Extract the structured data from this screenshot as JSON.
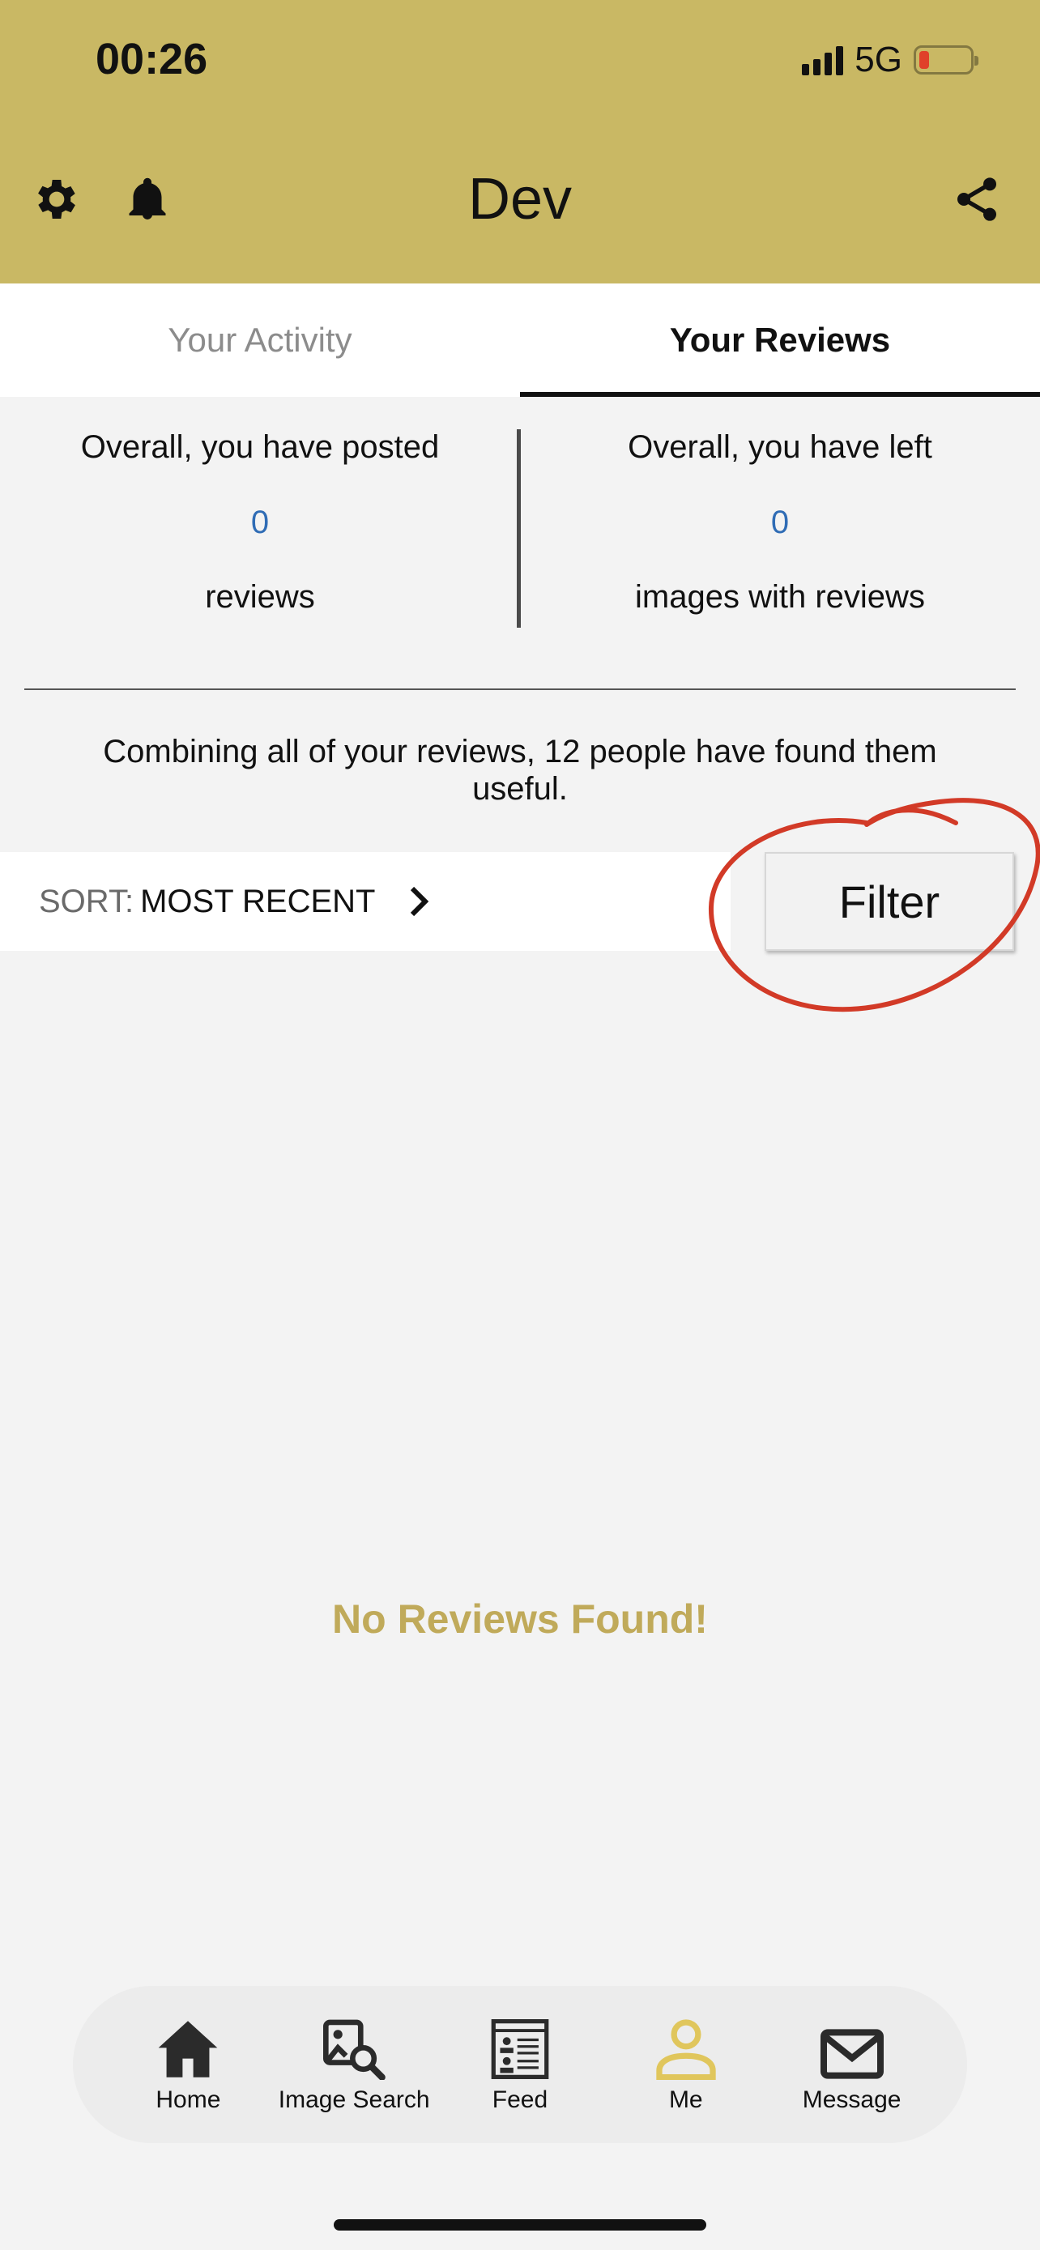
{
  "status": {
    "time": "00:26",
    "network": "5G"
  },
  "header": {
    "title": "Dev"
  },
  "tabs": [
    {
      "label": "Your Activity",
      "active": false
    },
    {
      "label": "Your Reviews",
      "active": true
    }
  ],
  "stats": {
    "left": {
      "line1": "Overall, you have posted",
      "value": "0",
      "line2": "reviews"
    },
    "right": {
      "line1": "Overall, you have left",
      "value": "0",
      "line2": "images with reviews"
    }
  },
  "useful_text": "Combining all of your reviews, 12 people have found them useful.",
  "sort": {
    "label": "SORT:",
    "value": "MOST RECENT"
  },
  "filter": {
    "label": "Filter"
  },
  "empty_message": "No Reviews Found!",
  "bottom_nav": [
    {
      "label": "Home",
      "icon": "home-icon",
      "active": false
    },
    {
      "label": "Image Search",
      "icon": "image-search-icon",
      "active": false
    },
    {
      "label": "Feed",
      "icon": "feed-icon",
      "active": false
    },
    {
      "label": "Me",
      "icon": "person-icon",
      "active": true
    },
    {
      "label": "Message",
      "icon": "mail-icon",
      "active": false
    }
  ],
  "colors": {
    "header_bg": "#c9b864",
    "accent_gold": "#c0aa5a",
    "active_nav": "#e0c65c",
    "count_blue": "#2f6cb5",
    "annotation_red": "#d23a27"
  }
}
